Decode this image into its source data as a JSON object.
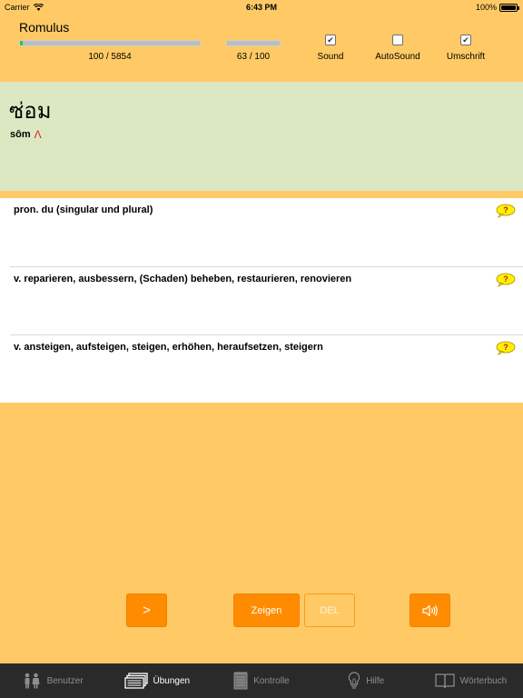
{
  "status": {
    "carrier": "Carrier",
    "time": "6:43 PM",
    "battery": "100%"
  },
  "header": {
    "user": "Romulus",
    "progress_total": {
      "label": "100 / 5854",
      "fraction": 0.017
    },
    "progress_session": {
      "label": "63 / 100",
      "fraction": 0
    },
    "options": [
      {
        "label": "Sound",
        "checked": true
      },
      {
        "label": "AutoSound",
        "checked": false
      },
      {
        "label": "Umschrift",
        "checked": true
      }
    ]
  },
  "word": {
    "thai": "ซ่อม",
    "transliteration": "sôm",
    "tone_mark": "Λ"
  },
  "meanings": [
    {
      "text": "pron. du (singular und plural)"
    },
    {
      "text": "v. reparieren, ausbessern, (Schaden) beheben, restaurieren, renovieren"
    },
    {
      "text": "v. ansteigen, aufsteigen, steigen, erhöhen, heraufsetzen, steigern"
    }
  ],
  "buttons": {
    "next": ">",
    "show": "Zeigen",
    "delete": "DEL"
  },
  "tabs": [
    {
      "label": "Benutzer",
      "icon": "users-icon",
      "active": false
    },
    {
      "label": "Übungen",
      "icon": "cards-icon",
      "active": true
    },
    {
      "label": "Kontrolle",
      "icon": "notepad-icon",
      "active": false
    },
    {
      "label": "Hilfe",
      "icon": "lightbulb-icon",
      "active": false
    },
    {
      "label": "Wörterbuch",
      "icon": "book-icon",
      "active": false
    }
  ],
  "colors": {
    "background": "#FFCA66",
    "word_panel": "#DBE8C2",
    "accent": "#FF8C00",
    "progress": "#2DCB2D",
    "tab_bar": "#2A2A2A"
  }
}
